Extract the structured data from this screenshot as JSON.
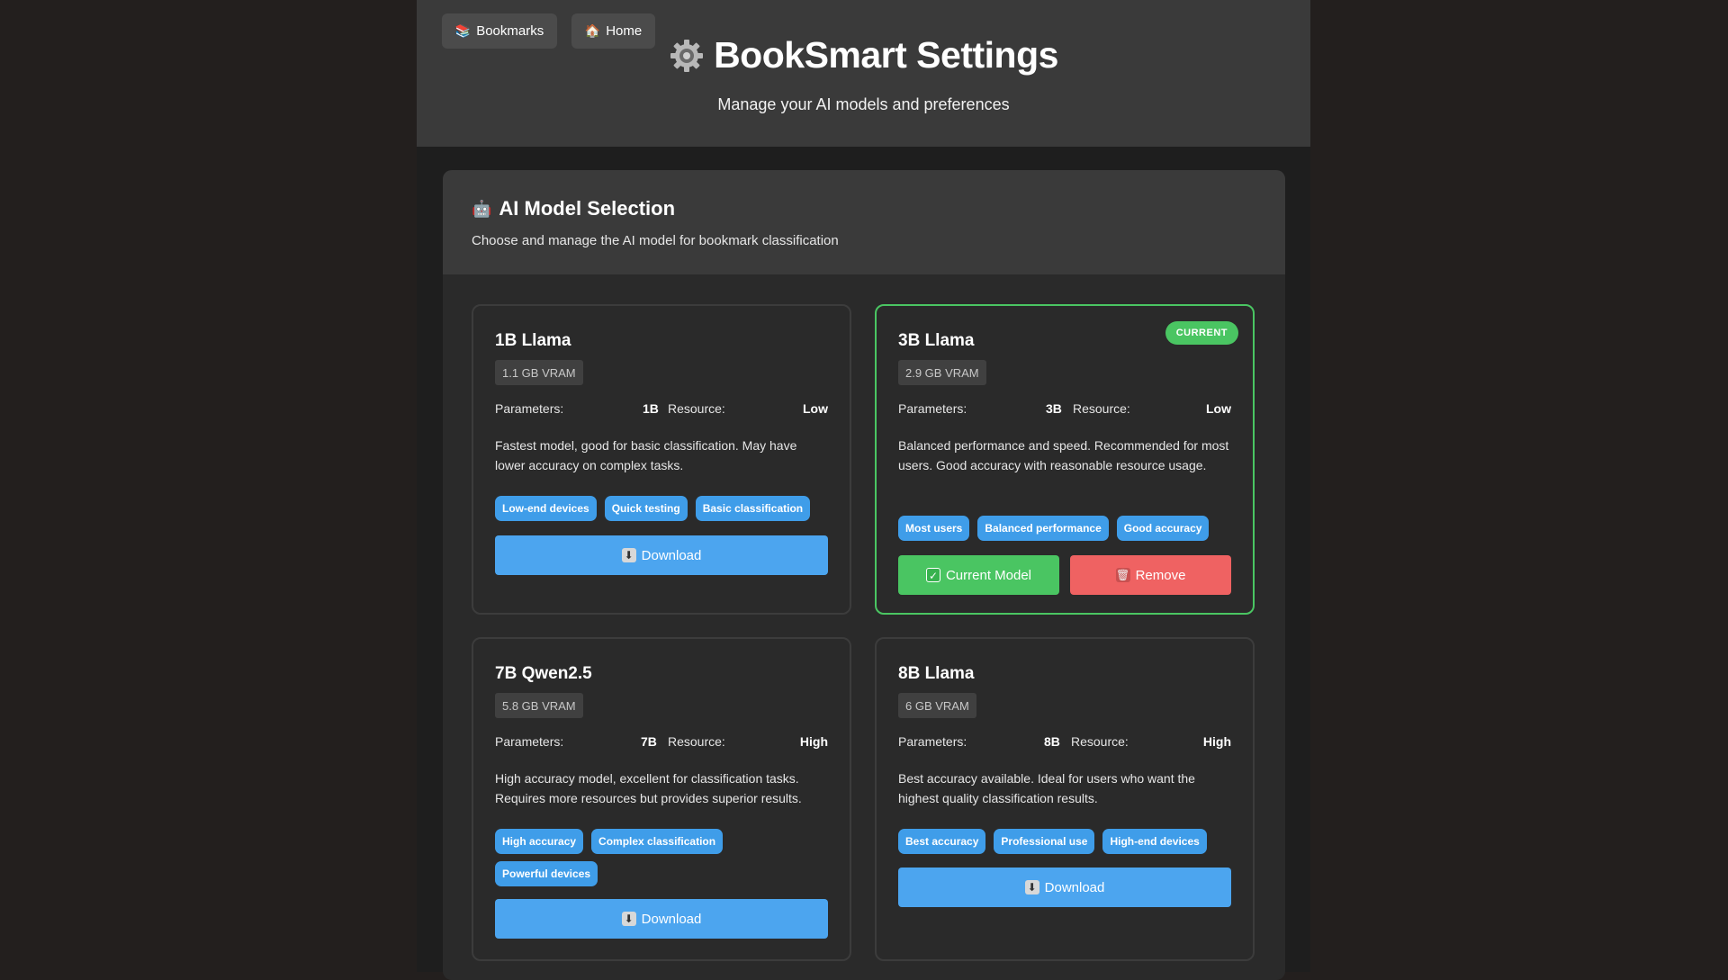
{
  "nav": {
    "bookmarks": {
      "icon": "📚",
      "label": "Bookmarks"
    },
    "home": {
      "icon": "🏠",
      "label": "Home"
    }
  },
  "header": {
    "title": "BookSmart Settings",
    "subtitle": "Manage your AI models and preferences"
  },
  "panel": {
    "icon": "🤖",
    "title": "AI Model Selection",
    "subtitle": "Choose and manage the AI model for bookmark classification"
  },
  "labels": {
    "parameters": "Parameters:",
    "resource": "Resource:",
    "download": "Download",
    "current_model": "Current Model",
    "remove": "Remove",
    "current_badge": "CURRENT"
  },
  "models": [
    {
      "name": "1B Llama",
      "vram": "1.1 GB VRAM",
      "params": "1B",
      "resource": "Low",
      "description": "Fastest model, good for basic classification. May have lower accuracy on complex tasks.",
      "tags": [
        "Low-end devices",
        "Quick testing",
        "Basic classification"
      ]
    },
    {
      "name": "3B Llama",
      "vram": "2.9 GB VRAM",
      "params": "3B",
      "resource": "Low",
      "description": "Balanced performance and speed. Recommended for most users. Good accuracy with reasonable resource usage.",
      "tags": [
        "Most users",
        "Balanced performance",
        "Good accuracy"
      ]
    },
    {
      "name": "7B Qwen2.5",
      "vram": "5.8 GB VRAM",
      "params": "7B",
      "resource": "High",
      "description": "High accuracy model, excellent for classification tasks. Requires more resources but provides superior results.",
      "tags": [
        "High accuracy",
        "Complex classification",
        "Powerful devices"
      ]
    },
    {
      "name": "8B Llama",
      "vram": "6 GB VRAM",
      "params": "8B",
      "resource": "High",
      "description": "Best accuracy available. Ideal for users who want the highest quality classification results.",
      "tags": [
        "Best accuracy",
        "Professional use",
        "High-end devices"
      ]
    }
  ]
}
